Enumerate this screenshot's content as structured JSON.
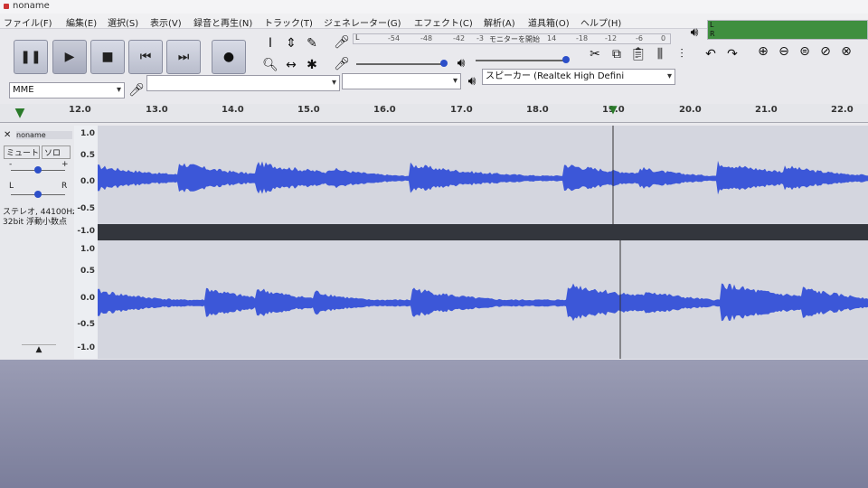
{
  "window": {
    "title": "noname"
  },
  "menu": [
    "ファイル(F)",
    "編集(E)",
    "選択(S)",
    "表示(V)",
    "録音と再生(N)",
    "トラック(T)",
    "ジェネレーター(G)",
    "エフェクト(C)",
    "解析(A)",
    "道具箱(O)",
    "ヘルプ(H)"
  ],
  "transport": {
    "pause": "❚❚",
    "play": "▶",
    "stop": "■",
    "skip_start": "⏮",
    "skip_end": "⏭",
    "record": "●"
  },
  "meters": {
    "record_ticks": [
      "-54",
      "-48",
      "-42",
      "-3"
    ],
    "record_hint": "モニターを開始",
    "play_ticks": [
      "14",
      "-18",
      "-12",
      "-6",
      "0"
    ],
    "lr": [
      "L",
      "R"
    ],
    "record_volume": 0.97,
    "play_volume": 0.98
  },
  "device": {
    "host": "MME",
    "input_device": "",
    "input_channels": "",
    "output_device": "スピーカー (Realtek High Defini"
  },
  "ruler": [
    "12.0",
    "13.0",
    "14.0",
    "15.0",
    "16.0",
    "17.0",
    "18.0",
    "19.0",
    "20.0",
    "21.0",
    "22.0"
  ],
  "track": {
    "name": "noname",
    "close": "✕",
    "mute_label": "ミュート",
    "solo_label": "ソロ",
    "gain_minus": "-",
    "gain_plus": "+",
    "pan_left": "L",
    "pan_right": "R",
    "info_line1": "ステレオ, 44100Hz",
    "info_line2": "32bit 浮動小数点",
    "collapse": "▲"
  },
  "scale": [
    "1.0",
    "0.5",
    "0.0",
    "-0.5",
    "-1.0"
  ],
  "colors": {
    "waveform": "#3c57d8",
    "track_bg": "#d4d6df",
    "separator": "#33363d"
  }
}
